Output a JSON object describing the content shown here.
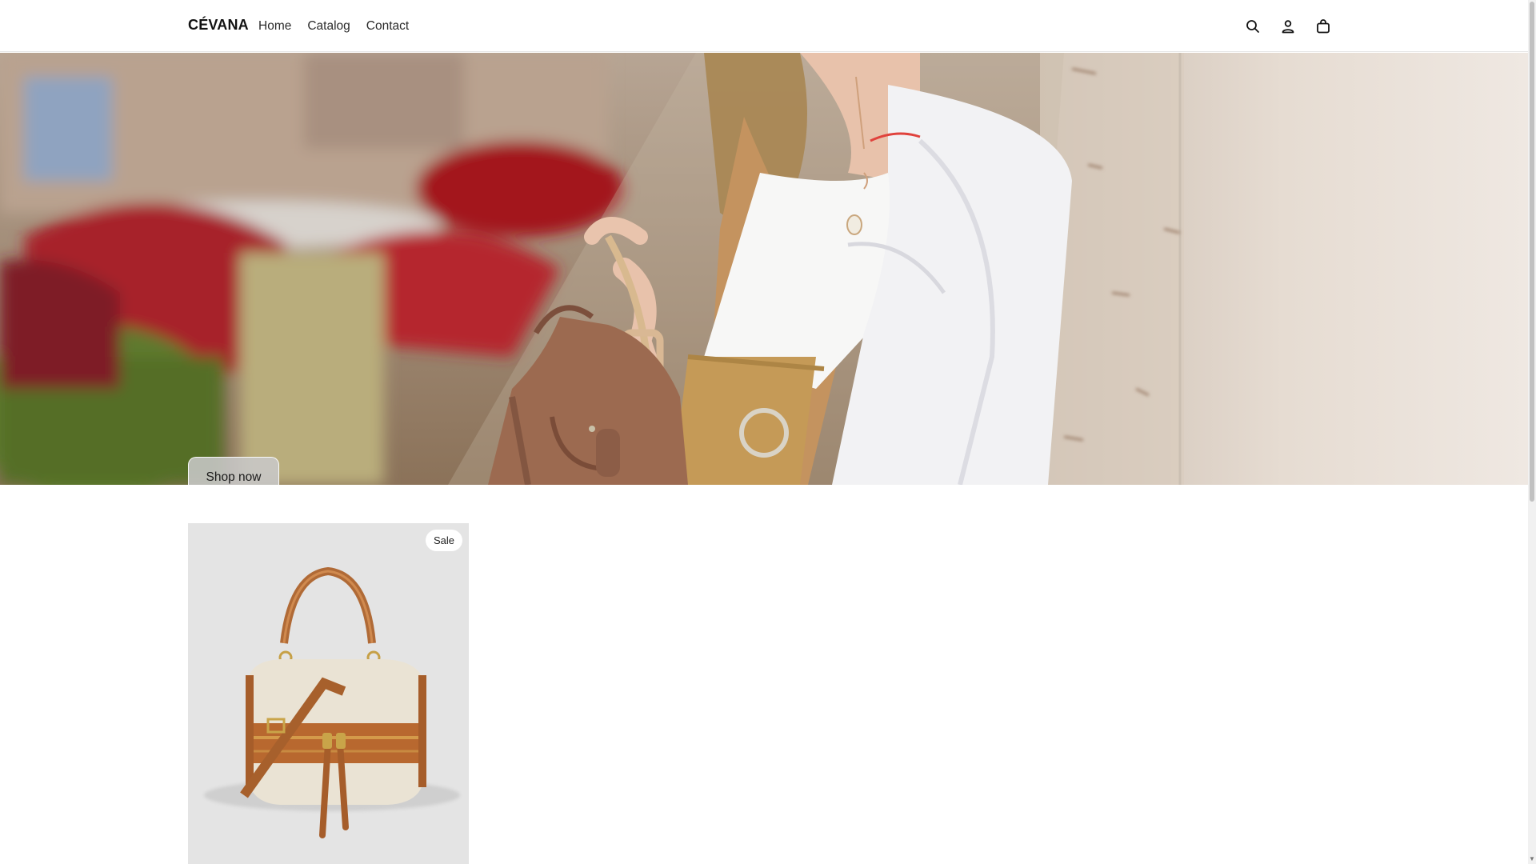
{
  "header": {
    "brand": "CÉVANA",
    "nav": [
      {
        "label": "Home"
      },
      {
        "label": "Catalog"
      },
      {
        "label": "Contact"
      }
    ],
    "icons": [
      "search-icon",
      "account-icon",
      "cart-icon"
    ]
  },
  "hero": {
    "cta_label": "Shop now"
  },
  "products": [
    {
      "badge": "Sale"
    }
  ],
  "colors": {
    "text": "#121212",
    "header_border": "#e6e6e6",
    "product_bg": "#e4e4e4",
    "button_bg": "#c8c8c8"
  }
}
